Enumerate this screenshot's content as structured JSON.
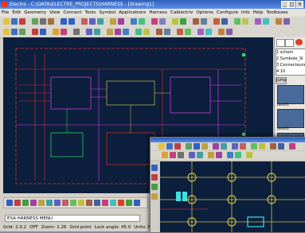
{
  "window": {
    "title": "Electre - C:\\DATA\\ELECTRE_PROJECTS\\HARNESS - [drawing1]"
  },
  "menu": [
    "File",
    "Edit",
    "Geometry",
    "View",
    "Connect",
    "Tools",
    "Symbol",
    "Applications",
    "Harness",
    "Cablectriv",
    "Options",
    "Configure",
    "Info",
    "Help",
    "Toolboxes"
  ],
  "panel": {
    "rows": [
      "1 schem",
      "2 Symbole_Sl",
      "3 Connecteurs",
      "4 10"
    ],
    "jump_label": "Jump",
    "thumbs": [
      "desi01",
      "desi02",
      "nova22"
    ]
  },
  "command": {
    "value": "ESA HARNESS MENU"
  },
  "status": {
    "grid": "Grid: 2.0,2",
    "mode": "OFF",
    "zoom": "Zoom: 1.26",
    "gridpoint": "Grid point",
    "lock": "Lock angle: 45.0",
    "units": "Units: MM 1.0"
  },
  "colors": {
    "canvas": "#0c1f3c",
    "wire_red": "#ff3040",
    "wire_magenta": "#e040ff",
    "wire_green": "#30e060",
    "component_yellow": "#d0c040"
  }
}
